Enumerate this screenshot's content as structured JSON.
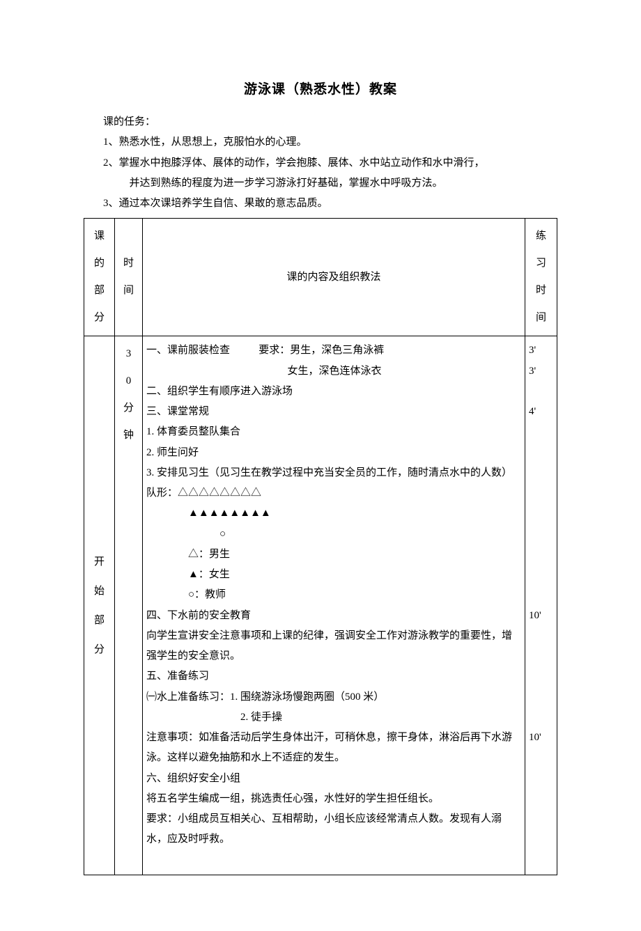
{
  "title": "游泳课（熟悉水性）教案",
  "tasks_label": "课的任务：",
  "tasks": {
    "t1": "1、熟悉水性，从思想上，克服怕水的心理。",
    "t2": "2、掌握水中抱膝浮体、展体的动作，学会抱膝、展体、水中站立动作和水中滑行，",
    "t2b": "并达到熟练的程度为进一步学习游泳打好基础，掌握水中呼吸方法。",
    "t3": "3、通过本次课培养学生自信、果敢的意志品质。"
  },
  "headers": {
    "part": "课的部分",
    "time": "时间",
    "content": "课的内容及组织教法",
    "practice": "练习时间"
  },
  "row1": {
    "part_label": "开始部分",
    "time_label": "30分钟",
    "content": {
      "l1a": "一、课前服装检查",
      "l1b": "要求：男生，深色三角泳裤",
      "l1c": "女生，深色连体泳衣",
      "l2": "二、组织学生有顺序进入游泳场",
      "l3": "三、课堂常规",
      "l3_1": "1. 体育委员整队集合",
      "l3_2": "2. 师生问好",
      "l3_3": "3. 安排见习生（见习生在教学过程中充当安全员的工作，随时清点水中的人数）",
      "formation_label": "队形：△△△△△△△△",
      "formation_row2": "▲▲▲▲▲▲▲▲",
      "formation_row3": "○",
      "legend_a": "△：男生",
      "legend_b": "▲：女生",
      "legend_c": "○：教师",
      "l4": "四、下水前的安全教育",
      "l4_body": "向学生宣讲安全注意事项和上课的纪律，强调安全工作对游泳教学的重要性，增强学生的安全意识。",
      "l5": "五、准备练习",
      "l5_1": "㈠水上准备练习：1. 围绕游泳场慢跑两圈（500 米）",
      "l5_2": "2. 徒手操",
      "note": "注意事项：如准备活动后学生身体出汗，可稍休息，擦干身体，淋浴后再下水游泳。这样以避免抽筋和水上不适症的发生。",
      "l6": "六、组织好安全小组",
      "l6_1": "将五名学生编成一组，挑选责任心强，水性好的学生担任组长。",
      "l6_2": "要求：小组成员互相关心、互相帮助，小组长应该经常清点人数。发现有人溺水，应及时呼救。"
    },
    "practice": {
      "p1": "3'",
      "p2": "3'",
      "p3": "4'",
      "p4": "10'",
      "p5": "10'"
    }
  }
}
